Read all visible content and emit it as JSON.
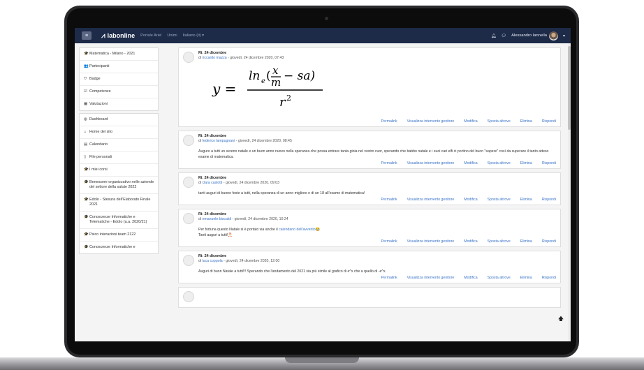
{
  "navbar": {
    "brand": "labonline",
    "links": [
      "Portale Ariel",
      "Unimi",
      "Italiano (it) ▾"
    ],
    "user_name": "Alessandro Iannella",
    "menu_caret": "▾"
  },
  "sidebar": {
    "course_group": [
      {
        "icon": "graduation-cap-icon",
        "glyph": "🎓",
        "label": "Matematica - Milano - 2021"
      },
      {
        "icon": "users-icon",
        "glyph": "👥",
        "label": "Partecipanti"
      },
      {
        "icon": "shield-icon",
        "glyph": "⛉",
        "label": "Badge"
      },
      {
        "icon": "check-square-icon",
        "glyph": "☑",
        "label": "Competenze"
      },
      {
        "icon": "table-icon",
        "glyph": "▦",
        "label": "Valutazioni"
      }
    ],
    "site_group": [
      {
        "icon": "dashboard-icon",
        "glyph": "◍",
        "label": "Dashboard"
      },
      {
        "icon": "home-icon",
        "glyph": "⌂",
        "label": "Home del sito"
      },
      {
        "icon": "calendar-icon",
        "glyph": "▤",
        "label": "Calendario"
      },
      {
        "icon": "file-icon",
        "glyph": "▯",
        "label": "File personali"
      },
      {
        "icon": "graduation-cap-icon",
        "glyph": "🎓",
        "label": "I miei corsi"
      },
      {
        "icon": "graduation-cap-icon",
        "glyph": "🎓",
        "label": "Benessere organizzativo nelle aziende del settore della salute 2022"
      },
      {
        "icon": "graduation-cap-icon",
        "glyph": "🎓",
        "label": "Edolo - Stesura dell'Elaborato Finale 2021"
      },
      {
        "icon": "graduation-cap-icon",
        "glyph": "🎓",
        "label": "Conoscenze Informatiche e Telematiche - Edolo (a.a. 2020/21)"
      },
      {
        "icon": "graduation-cap-icon",
        "glyph": "🎓",
        "label": "Psico interazioni team 2122"
      },
      {
        "icon": "graduation-cap-icon",
        "glyph": "🎓",
        "label": "Conoscenze Informatiche e"
      }
    ]
  },
  "posts": [
    {
      "subject": "Ri: 24 dicembre",
      "by": "di",
      "author": "riccardo mazza",
      "date": " - giovedì, 24 dicembre 2020, 07:43",
      "formula": {
        "y": "y =",
        "ln": "ln",
        "e": "e",
        "x": "x",
        "m": "m",
        "sa": "− sa)",
        "r": "r",
        "two": "2"
      }
    },
    {
      "subject": "Ri: 24 dicembre",
      "by": "di",
      "author": "federico lampugnani",
      "date": " - giovedì, 24 dicembre 2020, 08:45",
      "body": "Auguro a tutti un sereno natale e un buon anno nuovo nella speranza che possa entrare tanta gioia nel vostro cuor, sperando che babbo natale e i suoi cari elfi ci portino del buon \"sapere\" così da superare il tanto atteso esame di matematica."
    },
    {
      "subject": "Ri: 24 dicembre",
      "by": "di",
      "author": "clara caslotti",
      "date": " - giovedì, 24 dicembre 2020, 09:03",
      "body": "tanti auguri di buone feste a tutti, nella speranza di un anno migliore e di un 18 all'esame di matematica!"
    },
    {
      "subject": "Ri: 24 dicembre",
      "by": "di",
      "author": "emanuele biscaldi",
      "date": " - giovedì, 24 dicembre 2020, 10:24",
      "body_pre": "Per fortuna questo Natale si è portato via anche il ",
      "body_link": "calendario dell'avvento",
      "body_post": "😂",
      "body_line2": "Tanti auguri a tutti!🎅"
    },
    {
      "subject": "Ri: 24 dicembre",
      "by": "di",
      "author": "luca coppola",
      "date": " - giovedì, 24 dicembre 2020, 12:00",
      "body": "Auguri di buon Natale a tutti!!! Sperando che l'andamento del 2021 sia più simile al grafico di e^x che a quello di -e^x."
    }
  ],
  "actions": [
    "Permalink",
    "Visualizza intervento genitore",
    "Modifica",
    "Sposta altrove",
    "Elimina",
    "Rispondi"
  ],
  "scroll_top_glyph": "🡅"
}
